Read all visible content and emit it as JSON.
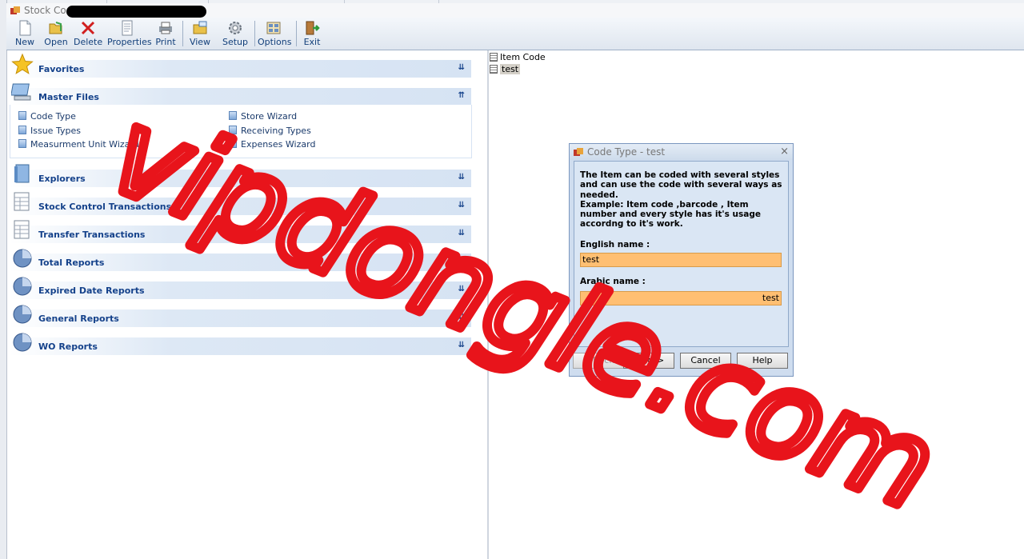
{
  "window": {
    "title": "Stock Co"
  },
  "toolbar": {
    "new": "New",
    "open": "Open",
    "delete": "Delete",
    "properties": "Properties",
    "print": "Print",
    "view": "View",
    "setup": "Setup",
    "options": "Options",
    "exit": "Exit"
  },
  "sidebar": {
    "favorites": "Favorites",
    "master_files": "Master Files",
    "master_items": [
      "Code Type",
      "Issue Types",
      "Measurment Unit Wizard",
      "Store Wizard",
      "Receiving Types",
      "Expenses Wizard"
    ],
    "explorers": "Explorers",
    "stock_control": "Stock Control Transactions",
    "transfer": "Transfer Transactions",
    "total_reports": "Total Reports",
    "expired_reports": "Expired Date Reports",
    "general_reports": "General Reports",
    "wo_reports": "WO Reports"
  },
  "tree": {
    "root": "Item Code",
    "child": "test"
  },
  "dialog": {
    "title": "Code Type - test",
    "description": "The Item can be coded with several styles and can use the code with several ways as needed.\nExample: Item code ,barcode , Item number and every style has it's usage accordng to it's work.",
    "english_label": "English name :",
    "english_value": "test",
    "arabic_label": "Arabic name :",
    "arabic_value": "test",
    "back": "< Back",
    "next": "Next >",
    "cancel": "Cancel",
    "help": "Help"
  },
  "watermark": {
    "text": "vipdongle.com",
    "color": "#e8141b"
  }
}
